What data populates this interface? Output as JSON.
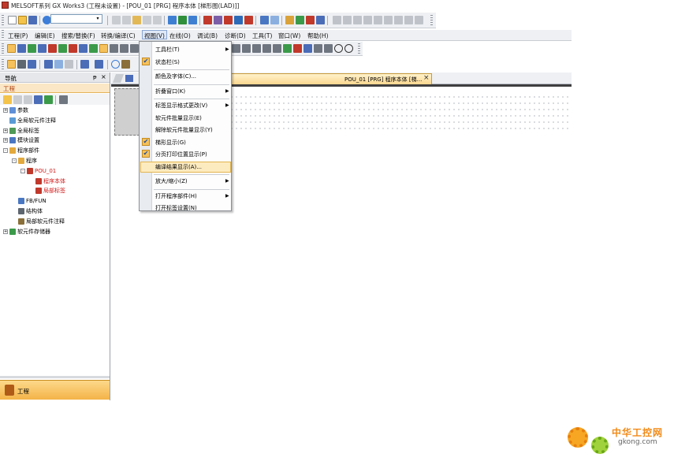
{
  "window": {
    "title": "MELSOFT系列 GX Works3 (工程未设置) - [POU_01 [PRG] 程序本体 [梯形图(LAD)]]"
  },
  "menubar": {
    "items": [
      "工程(P)",
      "编辑(E)",
      "搜索/替换(F)",
      "转换/编译(C)",
      "视图(V)",
      "在线(O)",
      "调试(B)",
      "诊断(D)",
      "工具(T)",
      "窗口(W)",
      "帮助(H)"
    ]
  },
  "navigation": {
    "title": "导航",
    "pin_glyph": "ᵽ",
    "close_glyph": "×",
    "section": "工程",
    "tree": [
      {
        "label": "参数",
        "level": 0,
        "exp": "+",
        "red": false
      },
      {
        "label": "全局软元件注释",
        "level": 0,
        "exp": "",
        "red": false
      },
      {
        "label": "全局标签",
        "level": 0,
        "exp": "+",
        "red": false
      },
      {
        "label": "模块设置",
        "level": 0,
        "exp": "+",
        "red": false
      },
      {
        "label": "程序部件",
        "level": 0,
        "exp": "-",
        "red": false
      },
      {
        "label": "程序",
        "level": 1,
        "exp": "-",
        "red": false
      },
      {
        "label": "POU_01",
        "level": 2,
        "exp": "-",
        "red": true
      },
      {
        "label": "程序本体",
        "level": 3,
        "exp": "",
        "red": true
      },
      {
        "label": "局部标签",
        "level": 3,
        "exp": "",
        "red": true
      },
      {
        "label": "FB/FUN",
        "level": 1,
        "exp": "",
        "red": false
      },
      {
        "label": "结构体",
        "level": 1,
        "exp": "",
        "red": false
      },
      {
        "label": "局部软元件注释",
        "level": 1,
        "exp": "",
        "red": false
      },
      {
        "label": "软元件存储器",
        "level": 0,
        "exp": "+",
        "red": false
      }
    ],
    "bottom_tab": "工程"
  },
  "document": {
    "tab_label": "POU_01 [PRG] 程序本体 [梯...",
    "tab_close": "×"
  },
  "view_menu": {
    "items": [
      {
        "label": "工具栏(T)",
        "checked": false,
        "submenu": true
      },
      {
        "label": "状态栏(S)",
        "checked": true,
        "submenu": false
      },
      {
        "label": "颜色及字体(C)...",
        "checked": false,
        "submenu": false,
        "sep_before": true
      },
      {
        "label": "折叠窗口(K)",
        "checked": false,
        "submenu": true,
        "sep_before": true
      },
      {
        "label": "标签显示格式更改(V)",
        "checked": false,
        "submenu": true,
        "sep_before": true
      },
      {
        "label": "软元件批量显示(E)",
        "checked": false,
        "submenu": false
      },
      {
        "label": "解除软元件批量显示(Y)",
        "checked": false,
        "submenu": false
      },
      {
        "label": "梯形显示(G)",
        "checked": true,
        "submenu": false
      },
      {
        "label": "分页打印位置显示(P)",
        "checked": true,
        "submenu": false
      },
      {
        "label": "编译结果显示(A)...",
        "checked": false,
        "submenu": false,
        "highlighted": true
      },
      {
        "label": "放大/缩小(Z)",
        "checked": false,
        "submenu": true,
        "sep_before": true
      },
      {
        "label": "打开程序部件(H)",
        "checked": false,
        "submenu": true,
        "sep_before": true
      },
      {
        "label": "打开标签设置(N)",
        "checked": false,
        "submenu": false
      }
    ],
    "check_glyph": "✔",
    "arrow_glyph": "▶"
  },
  "watermark": {
    "cn": "中华工控网",
    "en": "gkong.com"
  },
  "colors": {
    "accent_orange": "#f4b348",
    "tree_red": "#d11a1a"
  }
}
